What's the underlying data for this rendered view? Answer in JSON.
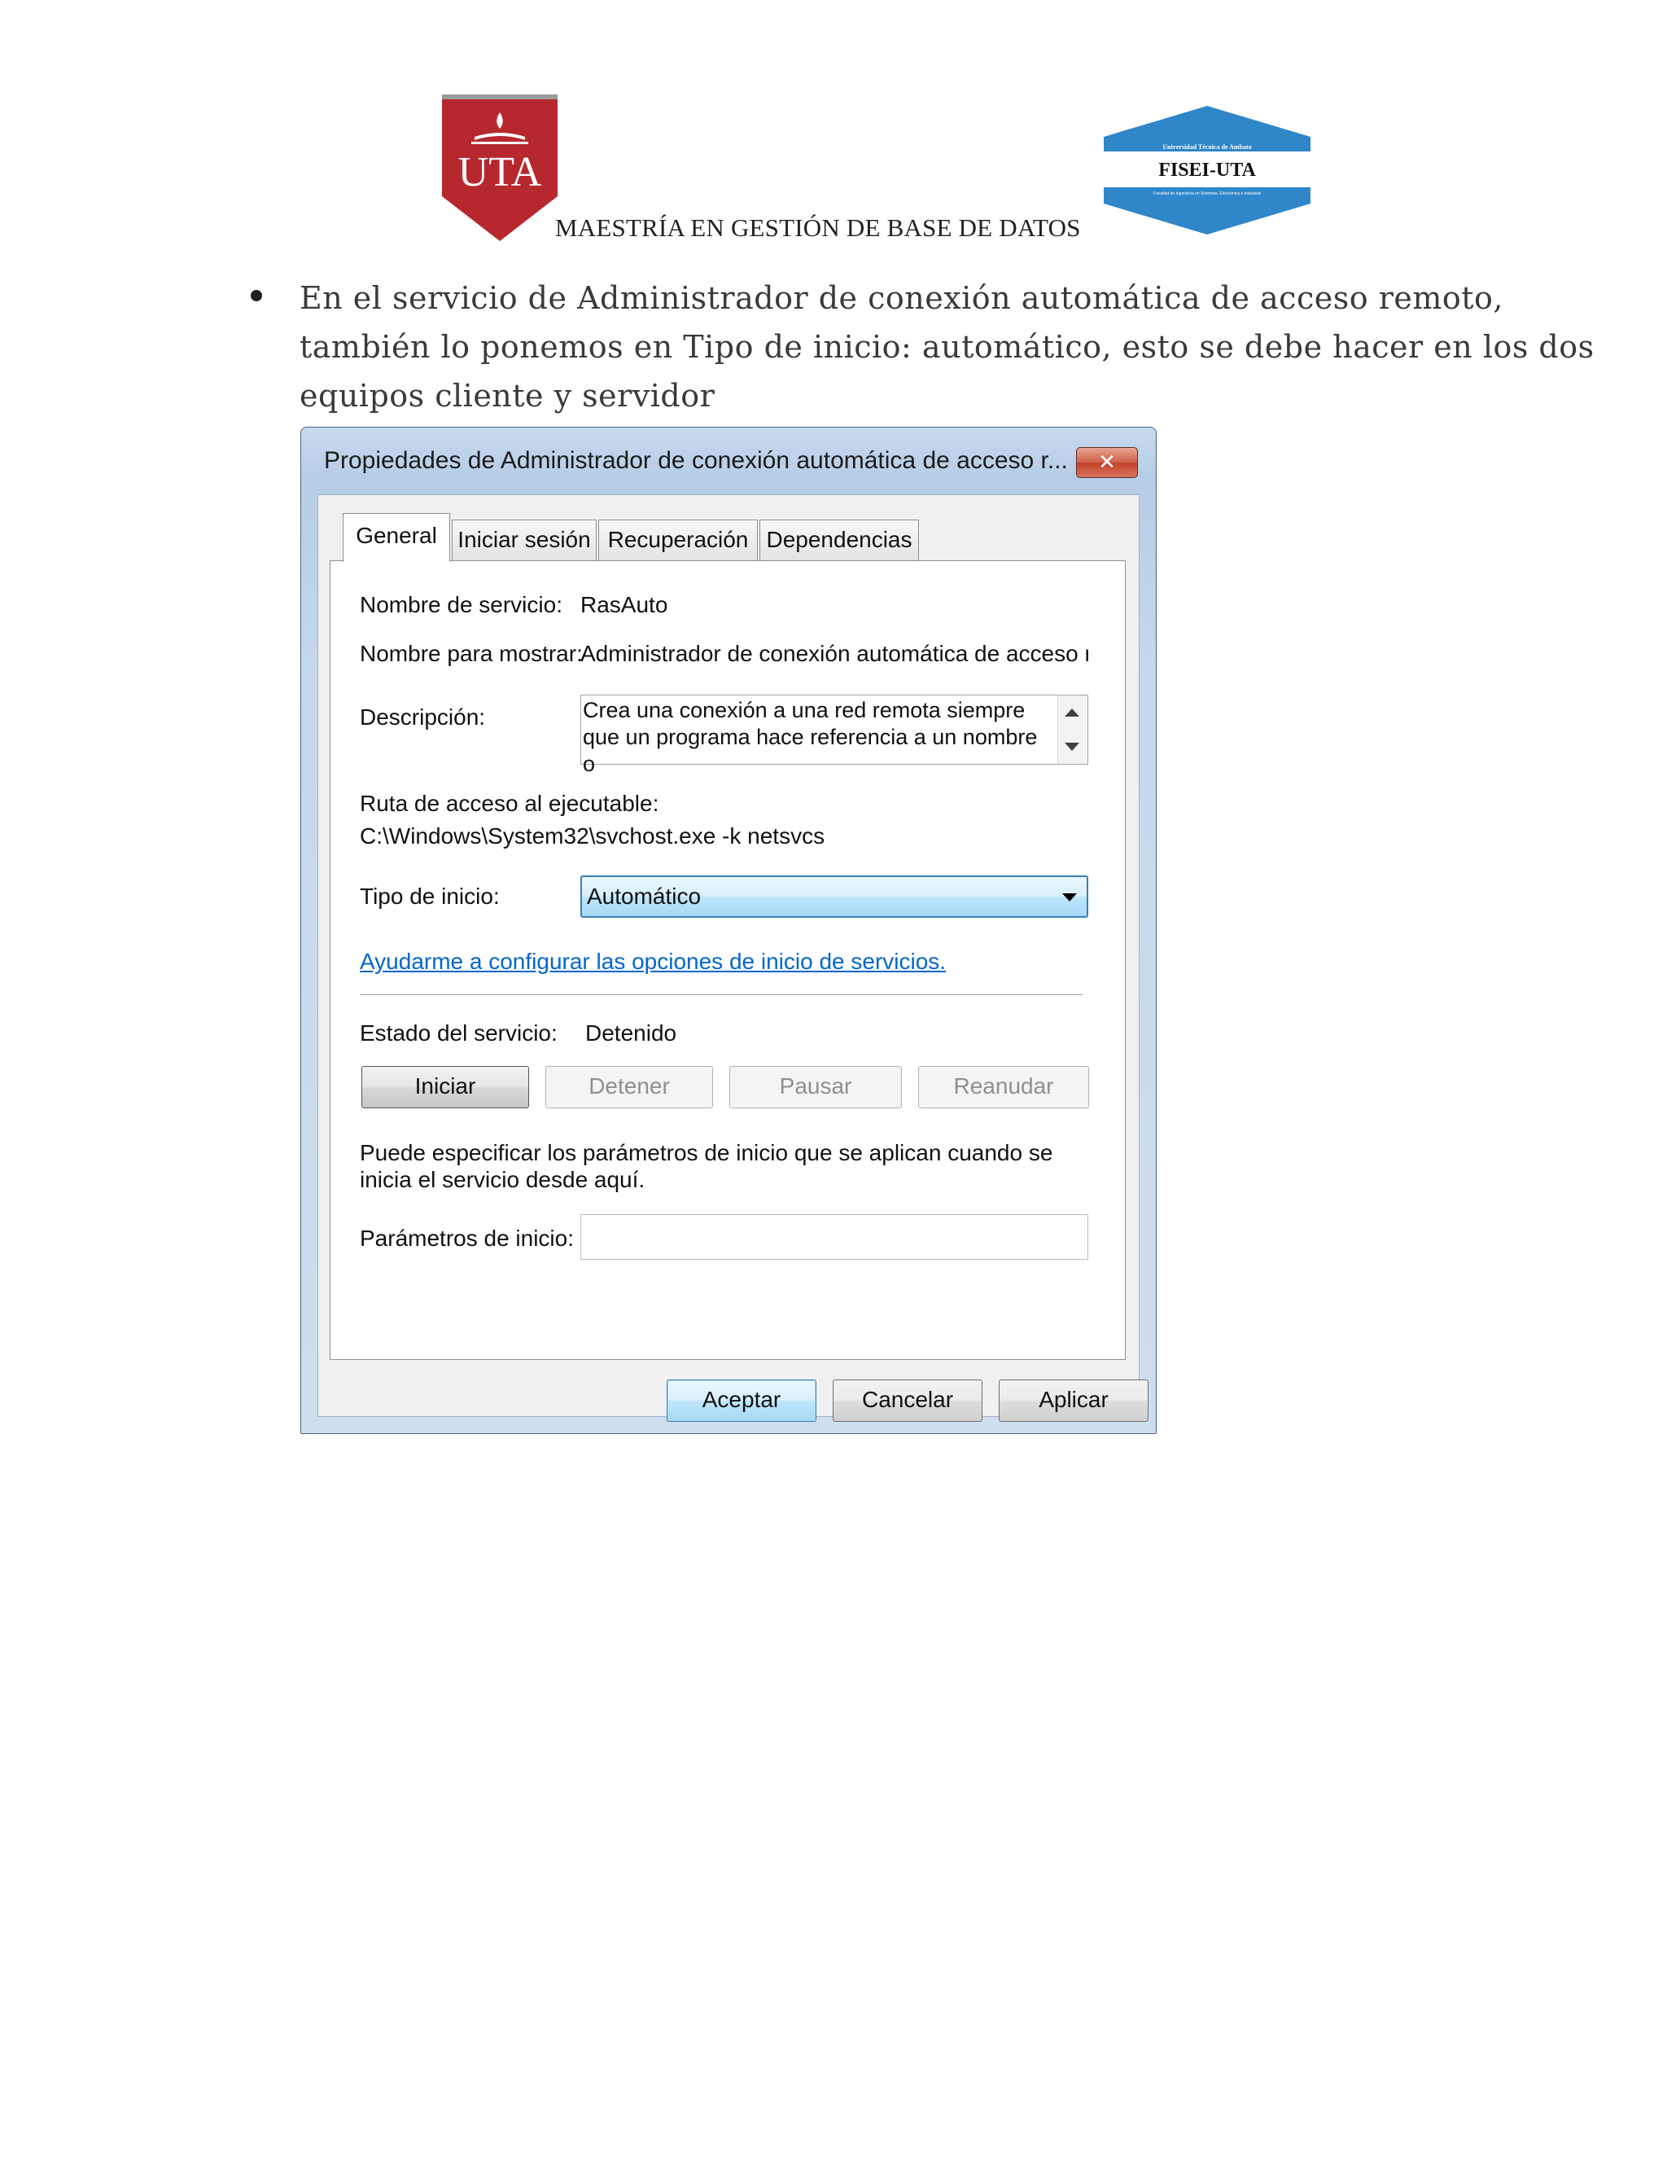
{
  "header": {
    "uta_logo_text": "UTA",
    "fisei_logo_top": "Universidad Técnica de Ambato",
    "fisei_logo_main": "FISEI-UTA",
    "fisei_logo_bottom": "Facultad de Ingeniería en Sistemas, Electrónica e Industrial",
    "title": "MAESTRÍA EN GESTIÓN DE BASE DE DATOS"
  },
  "bullet": {
    "text": "En el servicio de Administrador de conexión automática de acceso remoto, también lo ponemos en Tipo de inicio: automático, esto se debe hacer en los dos equipos cliente y servidor"
  },
  "window": {
    "title": "Propiedades de Administrador de conexión automática de acceso r...",
    "close_label": "✕",
    "tabs": [
      {
        "label": "General",
        "active": true
      },
      {
        "label": "Iniciar sesión",
        "active": false
      },
      {
        "label": "Recuperación",
        "active": false
      },
      {
        "label": "Dependencias",
        "active": false
      }
    ],
    "general": {
      "service_name_label": "Nombre de servicio:",
      "service_name_value": "RasAuto",
      "display_name_label": "Nombre para mostrar:",
      "display_name_value": "Administrador de conexión automática de acceso rem",
      "description_label": "Descripción:",
      "description_value": "Crea una conexión a una red remota siempre que un programa hace referencia a un nombre o",
      "exe_path_label": "Ruta de acceso al ejecutable:",
      "exe_path_value": "C:\\Windows\\System32\\svchost.exe -k netsvcs",
      "startup_type_label": "Tipo de inicio:",
      "startup_type_value": "Automático",
      "help_link": "Ayudarme a configurar las opciones de inicio de servicios.",
      "status_label": "Estado del servicio:",
      "status_value": "Detenido",
      "buttons": {
        "start": "Iniciar",
        "stop": "Detener",
        "pause": "Pausar",
        "resume": "Reanudar"
      },
      "params_note": "Puede especificar los parámetros de inicio que se aplican cuando se inicia el servicio desde aquí.",
      "params_label": "Parámetros de inicio:",
      "params_value": ""
    },
    "footer": {
      "ok": "Aceptar",
      "cancel": "Cancelar",
      "apply": "Aplicar"
    }
  },
  "colors": {
    "uta_red": "#b7282e",
    "fisei_blue": "#2f86c8",
    "link_blue": "#0066cc"
  }
}
